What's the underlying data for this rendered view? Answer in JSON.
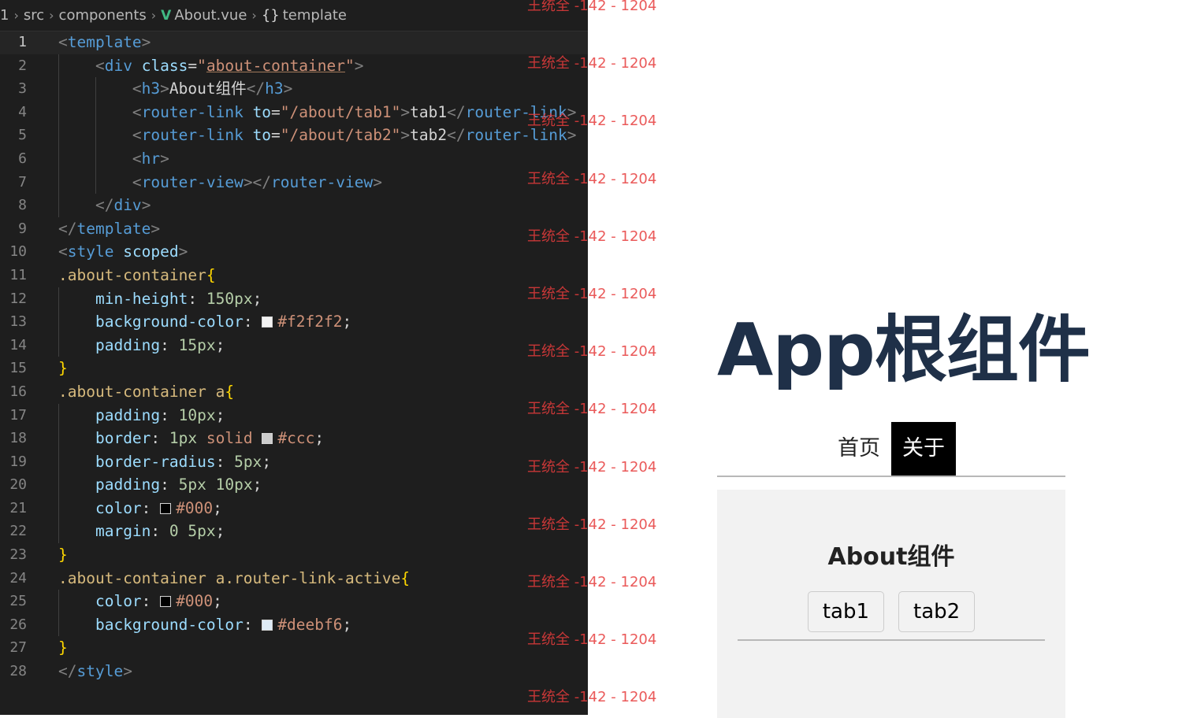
{
  "breadcrumb": {
    "items": [
      "1",
      "src",
      "components",
      "About.vue",
      "template"
    ]
  },
  "code": {
    "lines": [
      {
        "n": "1",
        "indent": 0,
        "current": true,
        "tokens": [
          [
            "pun",
            "<"
          ],
          [
            "tag",
            "template"
          ],
          [
            "pun",
            ">"
          ]
        ]
      },
      {
        "n": "2",
        "indent": 1,
        "tokens": [
          [
            "pun",
            "<"
          ],
          [
            "tag",
            "div"
          ],
          [
            "plain",
            " "
          ],
          [
            "attr",
            "class"
          ],
          [
            "eq",
            "="
          ],
          [
            "str",
            "\""
          ],
          [
            "strl",
            "about-container"
          ],
          [
            "str",
            "\""
          ],
          [
            "pun",
            ">"
          ]
        ]
      },
      {
        "n": "3",
        "indent": 2,
        "tokens": [
          [
            "pun",
            "<"
          ],
          [
            "tag",
            "h3"
          ],
          [
            "pun",
            ">"
          ],
          [
            "txt",
            "About组件"
          ],
          [
            "pun",
            "</"
          ],
          [
            "tag",
            "h3"
          ],
          [
            "pun",
            ">"
          ]
        ]
      },
      {
        "n": "4",
        "indent": 2,
        "tokens": [
          [
            "pun",
            "<"
          ],
          [
            "tag",
            "router-link"
          ],
          [
            "plain",
            " "
          ],
          [
            "attr",
            "to"
          ],
          [
            "eq",
            "="
          ],
          [
            "str",
            "\"/about/tab1\""
          ],
          [
            "pun",
            ">"
          ],
          [
            "txt",
            "tab1"
          ],
          [
            "pun",
            "</"
          ],
          [
            "tag",
            "router-link"
          ],
          [
            "pun",
            ">"
          ]
        ]
      },
      {
        "n": "5",
        "indent": 2,
        "tokens": [
          [
            "pun",
            "<"
          ],
          [
            "tag",
            "router-link"
          ],
          [
            "plain",
            " "
          ],
          [
            "attr",
            "to"
          ],
          [
            "eq",
            "="
          ],
          [
            "str",
            "\"/about/tab2\""
          ],
          [
            "pun",
            ">"
          ],
          [
            "txt",
            "tab2"
          ],
          [
            "pun",
            "</"
          ],
          [
            "tag",
            "router-link"
          ],
          [
            "pun",
            ">"
          ]
        ]
      },
      {
        "n": "6",
        "indent": 2,
        "tokens": [
          [
            "pun",
            "<"
          ],
          [
            "tag",
            "hr"
          ],
          [
            "pun",
            ">"
          ]
        ]
      },
      {
        "n": "7",
        "indent": 2,
        "tokens": [
          [
            "pun",
            "<"
          ],
          [
            "tag",
            "router-view"
          ],
          [
            "pun",
            "></"
          ],
          [
            "tag",
            "router-view"
          ],
          [
            "pun",
            ">"
          ]
        ]
      },
      {
        "n": "8",
        "indent": 1,
        "tokens": [
          [
            "pun",
            "</"
          ],
          [
            "tag",
            "div"
          ],
          [
            "pun",
            ">"
          ]
        ]
      },
      {
        "n": "9",
        "indent": 0,
        "tokens": [
          [
            "pun",
            "</"
          ],
          [
            "tag",
            "template"
          ],
          [
            "pun",
            ">"
          ]
        ]
      },
      {
        "n": "10",
        "indent": 0,
        "tokens": [
          [
            "pun",
            "<"
          ],
          [
            "tag",
            "style"
          ],
          [
            "plain",
            " "
          ],
          [
            "attr",
            "scoped"
          ],
          [
            "pun",
            ">"
          ]
        ]
      },
      {
        "n": "11",
        "indent": 0,
        "tokens": [
          [
            "sel",
            ".about-container"
          ],
          [
            "brace",
            "{"
          ]
        ]
      },
      {
        "n": "12",
        "indent": 1,
        "tokens": [
          [
            "prop",
            "min-height"
          ],
          [
            "plain",
            ": "
          ],
          [
            "num",
            "150px"
          ],
          [
            "plain",
            ";"
          ]
        ]
      },
      {
        "n": "13",
        "indent": 1,
        "tokens": [
          [
            "prop",
            "background-color"
          ],
          [
            "plain",
            ": "
          ],
          [
            "swatch",
            "#f2f2f2"
          ],
          [
            "hex",
            "#f2f2f2"
          ],
          [
            "plain",
            ";"
          ]
        ]
      },
      {
        "n": "14",
        "indent": 1,
        "tokens": [
          [
            "prop",
            "padding"
          ],
          [
            "plain",
            ": "
          ],
          [
            "num",
            "15px"
          ],
          [
            "plain",
            ";"
          ]
        ]
      },
      {
        "n": "15",
        "indent": 0,
        "tokens": [
          [
            "brace",
            "}"
          ]
        ]
      },
      {
        "n": "16",
        "indent": 0,
        "tokens": [
          [
            "sel",
            ".about-container a"
          ],
          [
            "brace",
            "{"
          ]
        ]
      },
      {
        "n": "17",
        "indent": 1,
        "tokens": [
          [
            "prop",
            "padding"
          ],
          [
            "plain",
            ": "
          ],
          [
            "num",
            "10px"
          ],
          [
            "plain",
            ";"
          ]
        ]
      },
      {
        "n": "18",
        "indent": 1,
        "tokens": [
          [
            "prop",
            "border"
          ],
          [
            "plain",
            ": "
          ],
          [
            "num",
            "1px"
          ],
          [
            "plain",
            " "
          ],
          [
            "kw",
            "solid"
          ],
          [
            "plain",
            " "
          ],
          [
            "swatch",
            "#cccccc"
          ],
          [
            "hex",
            "#ccc"
          ],
          [
            "plain",
            ";"
          ]
        ]
      },
      {
        "n": "19",
        "indent": 1,
        "tokens": [
          [
            "prop",
            "border-radius"
          ],
          [
            "plain",
            ": "
          ],
          [
            "num",
            "5px"
          ],
          [
            "plain",
            ";"
          ]
        ]
      },
      {
        "n": "20",
        "indent": 1,
        "tokens": [
          [
            "prop",
            "padding"
          ],
          [
            "plain",
            ": "
          ],
          [
            "num",
            "5px 10px"
          ],
          [
            "plain",
            ";"
          ]
        ]
      },
      {
        "n": "21",
        "indent": 1,
        "tokens": [
          [
            "prop",
            "color"
          ],
          [
            "plain",
            ": "
          ],
          [
            "swatch",
            "#000000"
          ],
          [
            "hex",
            "#000"
          ],
          [
            "plain",
            ";"
          ]
        ]
      },
      {
        "n": "22",
        "indent": 1,
        "tokens": [
          [
            "prop",
            "margin"
          ],
          [
            "plain",
            ": "
          ],
          [
            "num",
            "0 5px"
          ],
          [
            "plain",
            ";"
          ]
        ]
      },
      {
        "n": "23",
        "indent": 0,
        "tokens": [
          [
            "brace",
            "}"
          ]
        ]
      },
      {
        "n": "24",
        "indent": 0,
        "tokens": [
          [
            "sel",
            ".about-container a.router-link-active"
          ],
          [
            "brace",
            "{"
          ]
        ]
      },
      {
        "n": "25",
        "indent": 1,
        "tokens": [
          [
            "prop",
            "color"
          ],
          [
            "plain",
            ": "
          ],
          [
            "swatch",
            "#000000"
          ],
          [
            "hex",
            "#000"
          ],
          [
            "plain",
            ";"
          ]
        ]
      },
      {
        "n": "26",
        "indent": 1,
        "tokens": [
          [
            "prop",
            "background-color"
          ],
          [
            "plain",
            ": "
          ],
          [
            "swatch",
            "#deebf6"
          ],
          [
            "hex",
            "#deebf6"
          ],
          [
            "plain",
            ";"
          ]
        ]
      },
      {
        "n": "27",
        "indent": 0,
        "tokens": [
          [
            "brace",
            "}"
          ]
        ]
      },
      {
        "n": "28",
        "indent": 0,
        "tokens": [
          [
            "pun",
            "</"
          ],
          [
            "tag",
            "style"
          ],
          [
            "pun",
            ">"
          ]
        ]
      }
    ]
  },
  "watermark": {
    "text": "王统全 -142 - 1204",
    "count": 13
  },
  "preview": {
    "app_title": "App根组件",
    "nav": {
      "home": "首页",
      "about": "关于"
    },
    "about": {
      "title": "About组件",
      "tab1": "tab1",
      "tab2": "tab2"
    }
  },
  "colors": {
    "editor_bg": "#1e1e1e",
    "active_nav_bg": "#000000",
    "about_bg": "#f2f2f2",
    "title_color": "#1f3048",
    "watermark": "#e63c3c"
  }
}
